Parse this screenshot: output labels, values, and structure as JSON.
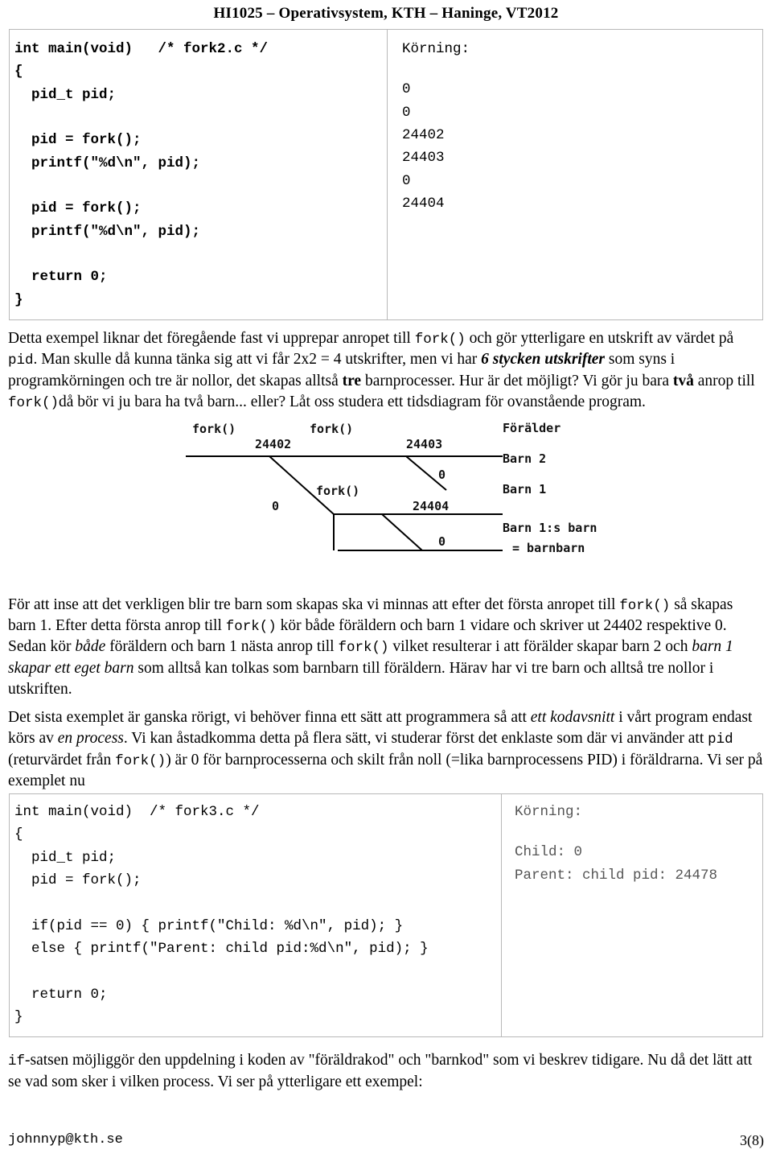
{
  "header": {
    "title": "HI1025 – Operativsystem, KTH – Haninge, VT2012"
  },
  "code_block_1": {
    "source": "int main(void)   /* fork2.c */\n{\n  pid_t pid;\n\n  pid = fork();\n  printf(\"%d\\n\", pid);\n\n  pid = fork();\n  printf(\"%d\\n\", pid);\n\n  return 0;\n}",
    "output_title": "Körning:",
    "output": "0\n0\n24402\n24403\n0\n24404"
  },
  "paragraph_1": {
    "part1": "Detta exempel liknar det föregående fast vi upprepar anropet till ",
    "code1": "fork()",
    "part2": " och gör ytterligare en utskrift av värdet på ",
    "code2": "pid",
    "part3": ". Man skulle då kunna tänka sig att vi får 2x2 = 4 utskrifter, men vi har ",
    "em1": "6 stycken utskrifter",
    "part4": " som syns i programkörningen och tre är nollor, det skapas alltså ",
    "em2": "tre",
    "part5": " barnprocesser. Hur är det möjligt? Vi gör ju bara ",
    "em3": "två",
    "part6": " anrop till ",
    "code3": "fork()",
    "part7": "då bör vi ju bara ha två barn... eller? Låt oss studera ett tidsdiagram för ovanstående program."
  },
  "diagram": {
    "labels": {
      "fork_top_left": "fork()",
      "fork_top_right": "fork()",
      "fork_middle": "fork()",
      "pid_24402": "24402",
      "pid_24403": "24403",
      "zero_1": "0",
      "zero_2": "0",
      "pid_24404": "24404",
      "zero_3": "0",
      "forelder": "Förälder",
      "barn2": "Barn 2",
      "barn1": "Barn 1",
      "barnbarn_line1": "Barn 1:s barn",
      "barnbarn_line2": "= barnbarn"
    }
  },
  "paragraph_2": {
    "part1": "För att inse att det verkligen blir tre barn som skapas ska vi minnas att efter det första anropet till ",
    "code1": "fork()",
    "part2": " så skapas barn 1. Efter detta första anrop till ",
    "code2": "fork()",
    "part3": " kör både föräldern och barn 1 vidare och skriver ut 24402 respektive 0. Sedan kör ",
    "em1": "både",
    "part4": " föräldern och barn 1 nästa anrop till ",
    "code3": "fork()",
    "part5": " vilket resulterar i att förälder skapar barn 2 och ",
    "em2": "barn 1 skapar ett eget barn",
    "part6": " som alltså kan tolkas som barnbarn till föräldern. Härav har vi tre barn och alltså tre nollor i utskriften."
  },
  "paragraph_3": {
    "part1": "Det sista exemplet är ganska rörigt, vi behöver finna ett sätt att programmera så att ",
    "em1": "ett kodavsnitt",
    "part2": " i vårt program endast körs av ",
    "em2": "en process",
    "part3": ". Vi kan åstadkomma detta på flera sätt, vi studerar först det enklaste som där vi använder att ",
    "code1": "pid",
    "part4": " (returvärdet från ",
    "code2": "fork()",
    "part5": ") är 0 för barnprocesserna och skilt från noll (=lika barnprocessens PID) i föräldrarna. Vi ser på exemplet nu"
  },
  "code_block_2": {
    "source": "int main(void)  /* fork3.c */\n{\n  pid_t pid;\n  pid = fork();\n\n  if(pid == 0) { printf(\"Child: %d\\n\", pid); }\n  else { printf(\"Parent: child pid:%d\\n\", pid); }\n\n  return 0;\n}",
    "output_title": "Körning:",
    "output": "Child: 0\nParent: child pid: 24478"
  },
  "paragraph_4": {
    "code1": "if",
    "part1": "-satsen möjliggör den uppdelning i koden av \"föräldrakod\" och \"barnkod\" som vi beskrev tidigare. Nu då det lätt att se vad som sker i vilken process. Vi ser på ytterligare ett exempel:"
  },
  "footer": {
    "email": "johnnyp@kth.se",
    "page": "3(8)"
  }
}
